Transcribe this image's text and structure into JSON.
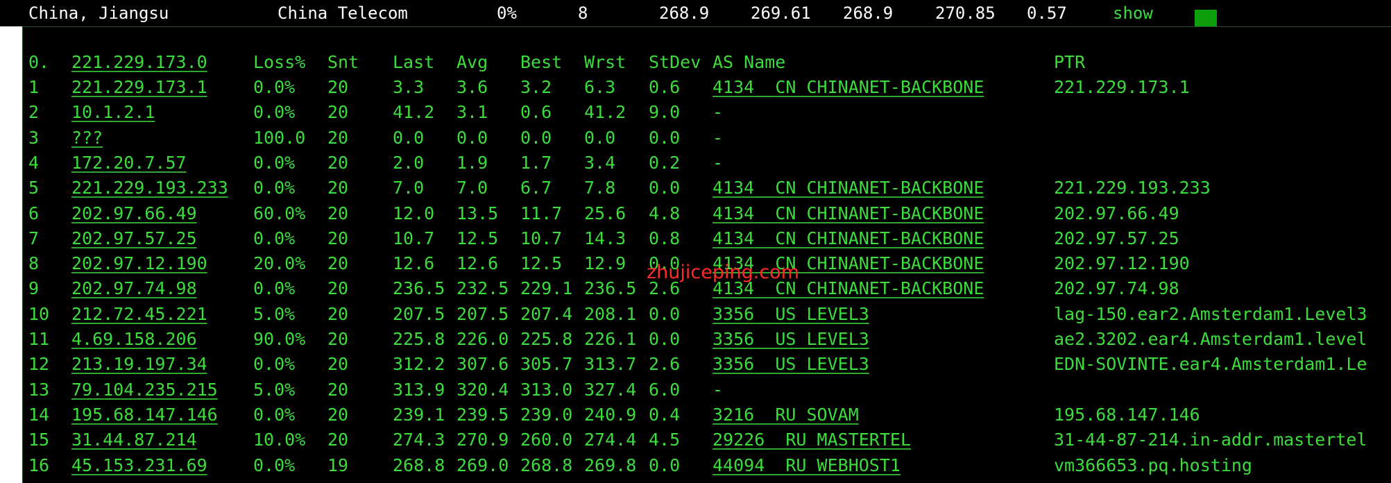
{
  "summary": {
    "location": "China, Jiangsu",
    "isp": "China Telecom",
    "loss": "0%",
    "sent": "8",
    "last": "268.9",
    "avg": "269.61",
    "best": "268.9",
    "worst": "270.85",
    "stdev": "0.57",
    "show_label": "show",
    "status_color": "#0e9e0e"
  },
  "headers": {
    "hop": "0.",
    "host": "221.229.173.0",
    "loss": "Loss%",
    "snt": "Snt",
    "last": "Last",
    "avg": "Avg",
    "best": "Best",
    "wrst": "Wrst",
    "stdev": "StDev",
    "asname": "AS Name",
    "ptr": "PTR"
  },
  "rows": [
    {
      "hop": "1",
      "host": "221.229.173.1",
      "loss": "0.0%",
      "snt": "20",
      "last": "3.3",
      "avg": "3.6",
      "best": "3.2",
      "wrst": "6.3",
      "stdev": "0.6",
      "asn": "4134",
      "country": "CN",
      "asname": "CHINANET-BACKBONE",
      "ptr": "221.229.173.1"
    },
    {
      "hop": "2",
      "host": "10.1.2.1",
      "loss": "0.0%",
      "snt": "20",
      "last": "41.2",
      "avg": "3.1",
      "best": "0.6",
      "wrst": "41.2",
      "stdev": "9.0",
      "asn": "-",
      "country": "",
      "asname": "",
      "ptr": ""
    },
    {
      "hop": "3",
      "host": "???",
      "loss": "100.0",
      "snt": "20",
      "last": "0.0",
      "avg": "0.0",
      "best": "0.0",
      "wrst": "0.0",
      "stdev": "0.0",
      "asn": "-",
      "country": "",
      "asname": "",
      "ptr": ""
    },
    {
      "hop": "4",
      "host": "172.20.7.57",
      "loss": "0.0%",
      "snt": "20",
      "last": "2.0",
      "avg": "1.9",
      "best": "1.7",
      "wrst": "3.4",
      "stdev": "0.2",
      "asn": "-",
      "country": "",
      "asname": "",
      "ptr": ""
    },
    {
      "hop": "5",
      "host": "221.229.193.233",
      "loss": "0.0%",
      "snt": "20",
      "last": "7.0",
      "avg": "7.0",
      "best": "6.7",
      "wrst": "7.8",
      "stdev": "0.0",
      "asn": "4134",
      "country": "CN",
      "asname": "CHINANET-BACKBONE",
      "ptr": "221.229.193.233"
    },
    {
      "hop": "6",
      "host": "202.97.66.49",
      "loss": "60.0%",
      "snt": "20",
      "last": "12.0",
      "avg": "13.5",
      "best": "11.7",
      "wrst": "25.6",
      "stdev": "4.8",
      "asn": "4134",
      "country": "CN",
      "asname": "CHINANET-BACKBONE",
      "ptr": "202.97.66.49"
    },
    {
      "hop": "7",
      "host": "202.97.57.25",
      "loss": "0.0%",
      "snt": "20",
      "last": "10.7",
      "avg": "12.5",
      "best": "10.7",
      "wrst": "14.3",
      "stdev": "0.8",
      "asn": "4134",
      "country": "CN",
      "asname": "CHINANET-BACKBONE",
      "ptr": "202.97.57.25"
    },
    {
      "hop": "8",
      "host": "202.97.12.190",
      "loss": "20.0%",
      "snt": "20",
      "last": "12.6",
      "avg": "12.6",
      "best": "12.5",
      "wrst": "12.9",
      "stdev": "0.0",
      "asn": "4134",
      "country": "CN",
      "asname": "CHINANET-BACKBONE",
      "ptr": "202.97.12.190"
    },
    {
      "hop": "9",
      "host": "202.97.74.98",
      "loss": "0.0%",
      "snt": "20",
      "last": "236.5",
      "avg": "232.5",
      "best": "229.1",
      "wrst": "236.5",
      "stdev": "2.6",
      "asn": "4134",
      "country": "CN",
      "asname": "CHINANET-BACKBONE",
      "ptr": "202.97.74.98"
    },
    {
      "hop": "10",
      "host": "212.72.45.221",
      "loss": "5.0%",
      "snt": "20",
      "last": "207.5",
      "avg": "207.5",
      "best": "207.4",
      "wrst": "208.1",
      "stdev": "0.0",
      "asn": "3356",
      "country": "US",
      "asname": "LEVEL3",
      "ptr": "lag-150.ear2.Amsterdam1.Level3"
    },
    {
      "hop": "11",
      "host": "4.69.158.206",
      "loss": "90.0%",
      "snt": "20",
      "last": "225.8",
      "avg": "226.0",
      "best": "225.8",
      "wrst": "226.1",
      "stdev": "0.0",
      "asn": "3356",
      "country": "US",
      "asname": "LEVEL3",
      "ptr": "ae2.3202.ear4.Amsterdam1.level"
    },
    {
      "hop": "12",
      "host": "213.19.197.34",
      "loss": "0.0%",
      "snt": "20",
      "last": "312.2",
      "avg": "307.6",
      "best": "305.7",
      "wrst": "313.7",
      "stdev": "2.6",
      "asn": "3356",
      "country": "US",
      "asname": "LEVEL3",
      "ptr": "EDN-SOVINTE.ear4.Amsterdam1.Le"
    },
    {
      "hop": "13",
      "host": "79.104.235.215",
      "loss": "5.0%",
      "snt": "20",
      "last": "313.9",
      "avg": "320.4",
      "best": "313.0",
      "wrst": "327.4",
      "stdev": "6.0",
      "asn": "-",
      "country": "",
      "asname": "",
      "ptr": ""
    },
    {
      "hop": "14",
      "host": "195.68.147.146",
      "loss": "0.0%",
      "snt": "20",
      "last": "239.1",
      "avg": "239.5",
      "best": "239.0",
      "wrst": "240.9",
      "stdev": "0.4",
      "asn": "3216",
      "country": "RU",
      "asname": "SOVAM",
      "ptr": "195.68.147.146"
    },
    {
      "hop": "15",
      "host": "31.44.87.214",
      "loss": "10.0%",
      "snt": "20",
      "last": "274.3",
      "avg": "270.9",
      "best": "260.0",
      "wrst": "274.4",
      "stdev": "4.5",
      "asn": "29226",
      "country": "RU",
      "asname": "MASTERTEL",
      "ptr": "31-44-87-214.in-addr.mastertel"
    },
    {
      "hop": "16",
      "host": "45.153.231.69",
      "loss": "0.0%",
      "snt": "19",
      "last": "268.8",
      "avg": "269.0",
      "best": "268.8",
      "wrst": "269.8",
      "stdev": "0.0",
      "asn": "44094",
      "country": "RU",
      "asname": "WEBHOST1",
      "ptr": "vm366653.pq.hosting"
    }
  ],
  "watermark": "zhujiceping.com"
}
